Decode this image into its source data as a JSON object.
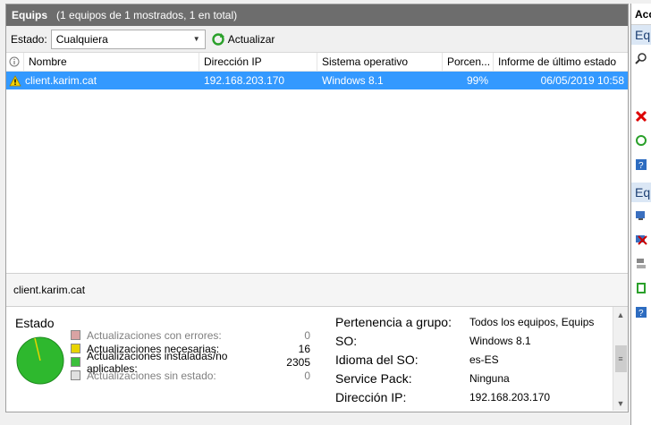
{
  "panel": {
    "title": "Equips",
    "subtitle": "(1 equipos de 1 mostrados, 1 en total)"
  },
  "toolbar": {
    "estado_label": "Estado:",
    "estado_value": "Cualquiera",
    "refresh_label": "Actualizar"
  },
  "grid": {
    "columns": [
      "Nombre",
      "Dirección IP",
      "Sistema operativo",
      "Porcen...",
      "Informe de último estado"
    ],
    "rows": [
      {
        "name": "client.karim.cat",
        "ip": "192.168.203.170",
        "os": "Windows 8.1",
        "percent": "99%",
        "last_report": "06/05/2019 10:58",
        "status_icon": "warning-icon"
      }
    ]
  },
  "selected_name": "client.karim.cat",
  "details": {
    "status_title": "Estado",
    "legend": [
      {
        "label": "Actualizaciones con errores:",
        "count": "0",
        "color": "#d9a3a3",
        "dim": true
      },
      {
        "label": "Actualizaciones necesarias:",
        "count": "16",
        "color": "#e8d400",
        "dim": false
      },
      {
        "label": "Actualizaciones instaladas/no aplicables:",
        "count": "2305",
        "color": "#3bbf3b",
        "dim": false
      },
      {
        "label": "Actualizaciones sin estado:",
        "count": "0",
        "color": "#e0e0e0",
        "dim": true
      }
    ],
    "properties": [
      {
        "key": "Pertenencia a grupo:",
        "value": "Todos los equipos, Equips"
      },
      {
        "key": "SO:",
        "value": "Windows 8.1"
      },
      {
        "key": "Idioma del SO:",
        "value": "es-ES"
      },
      {
        "key": "Service Pack:",
        "value": "Ninguna"
      },
      {
        "key": "Dirección IP:",
        "value": "192.168.203.170"
      }
    ]
  },
  "side_panel": {
    "header": "Acc",
    "section1": "Eq",
    "section2": "Eq"
  },
  "colors": {
    "title_bar": "#6d6d6d",
    "selection": "#3399ff",
    "pie_green": "#2eb82e"
  }
}
